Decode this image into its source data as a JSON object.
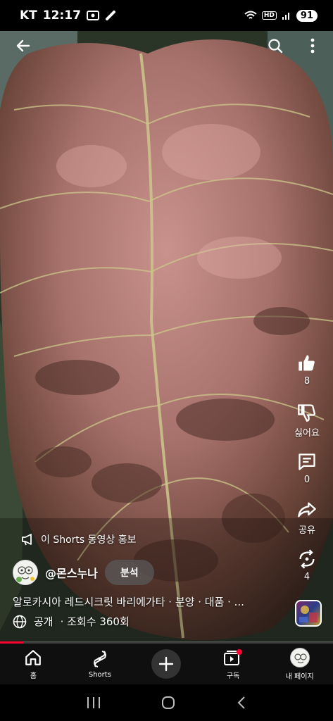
{
  "status_bar": {
    "carrier": "KT",
    "time": "12:17",
    "network": "HD",
    "battery": "91"
  },
  "top_bar": {
    "back_icon": "back-arrow-icon",
    "search_icon": "search-icon",
    "more_icon": "more-vert-icon"
  },
  "actions": {
    "like_count": "8",
    "dislike_label": "싫어요",
    "comment_count": "0",
    "share_label": "공유",
    "remix_count": "4"
  },
  "promo_label": "이 Shorts 동영상 홍보",
  "channel": {
    "name": "@몬스누나",
    "analyze_label": "분석"
  },
  "video_title": "알로카시아 레드시크릿 바리에가타  · 분양  · 대품  · ...",
  "meta": {
    "visibility": "공개",
    "views": "· 조회수 360회"
  },
  "progress": {
    "value": 0.07
  },
  "bottom_nav": [
    {
      "label": "홈",
      "icon": "home-icon"
    },
    {
      "label": "Shorts",
      "icon": "shorts-icon"
    },
    {
      "label": "",
      "icon": "create-plus-icon"
    },
    {
      "label": "구독",
      "icon": "subscriptions-icon"
    },
    {
      "label": "내 페이지",
      "icon": "profile-avatar-icon"
    }
  ],
  "colors": {
    "accent": "#ff0033",
    "leaf_pink": "#b07a78",
    "leaf_dark": "#5a3a30",
    "vein": "#c9c68a"
  }
}
